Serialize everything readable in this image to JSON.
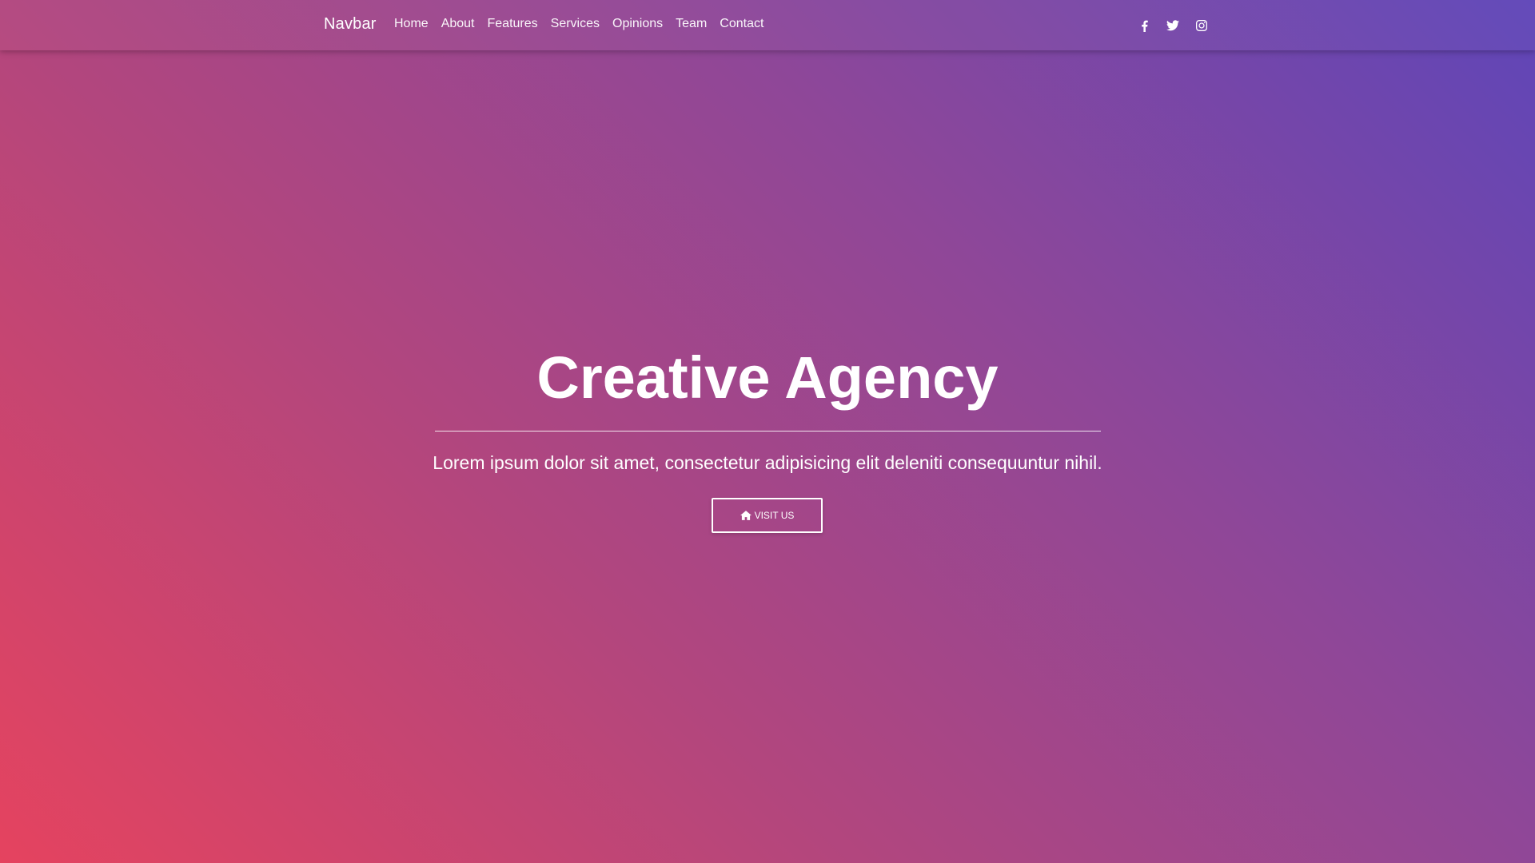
{
  "navbar": {
    "brand": "Navbar",
    "links": [
      {
        "label": "Home"
      },
      {
        "label": "About"
      },
      {
        "label": "Features"
      },
      {
        "label": "Services"
      },
      {
        "label": "Opinions"
      },
      {
        "label": "Team"
      },
      {
        "label": "Contact"
      }
    ],
    "socials": [
      {
        "icon": "facebook-icon"
      },
      {
        "icon": "twitter-icon"
      },
      {
        "icon": "instagram-icon"
      }
    ]
  },
  "hero": {
    "title": "Creative Agency",
    "lead": "Lorem ipsum dolor sit amet, consectetur adipisicing elit deleniti consequuntur nihil.",
    "button_label": "Visit us",
    "button_icon": "home-icon"
  },
  "colors": {
    "gradient_start": "#e5435f",
    "gradient_end": "#5f46b8",
    "text": "#ffffff"
  }
}
